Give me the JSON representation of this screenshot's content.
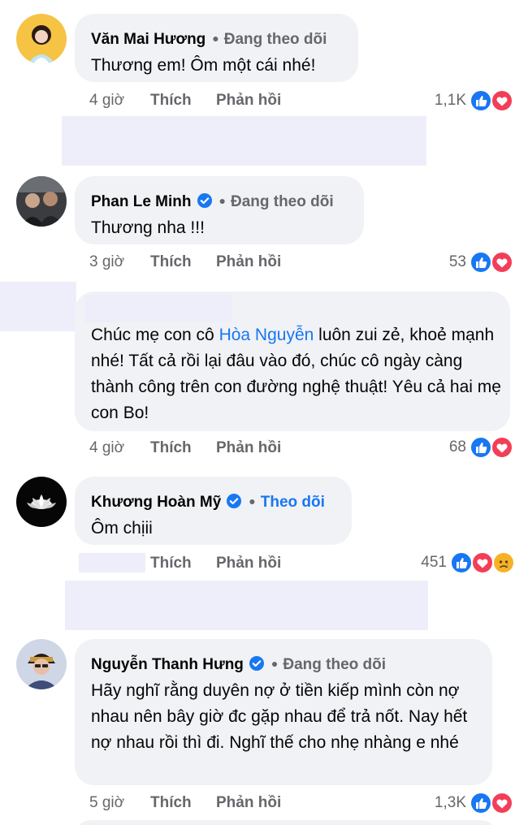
{
  "comments": [
    {
      "name": "Văn Mai Hương",
      "follow": "Đang theo dõi",
      "text": "Thương em! Ôm một cái nhé!",
      "time": "4 giờ",
      "like": "Thích",
      "reply": "Phản hồi",
      "reactions": "1,1K"
    },
    {
      "name": "Phan Le Minh",
      "follow": "Đang theo dõi",
      "text": "Thương nha !!!",
      "time": "3 giờ",
      "like": "Thích",
      "reply": "Phản hồi",
      "reactions": "53"
    },
    {
      "text_before": "Chúc mẹ con cô ",
      "mention": "Hòa Nguyễn",
      "text_after": " luôn zui zẻ, khoẻ mạnh nhé! Tất cả rồi lại đâu vào đó, chúc cô ngày càng thành công trên con đường nghệ thuật! Yêu cả hai mẹ con Bo!",
      "time": "4 giờ",
      "like": "Thích",
      "reply": "Phản hồi",
      "reactions": "68"
    },
    {
      "name": "Khương Hoàn Mỹ",
      "follow": "Theo dõi",
      "text": "Ôm chịii",
      "like": "Thích",
      "reply": "Phản hồi",
      "reactions": "451"
    },
    {
      "name": "Nguyễn Thanh Hưng",
      "follow": "Đang theo dõi",
      "text": "Hãy nghĩ rằng duyên nợ ở tiền kiếp mình còn nợ nhau nên bây giờ đc gặp nhau để trả nốt. Nay hết nợ nhau rồi thì đi. Nghĩ thế cho nhẹ nhàng e nhé",
      "time": "5 giờ",
      "like": "Thích",
      "reply": "Phản hồi",
      "reactions": "1,3K"
    }
  ],
  "colors": {
    "like_blue": "#1877f2",
    "love_red": "#f33e58",
    "sad_yellow": "#f7b125",
    "bubble_bg": "#f0f2f5",
    "secondary_text": "#65676b",
    "redaction": "#eeeefb"
  },
  "icons": {
    "verified": "verified-badge-icon",
    "like": "like-reaction-icon",
    "love": "love-reaction-icon",
    "sad": "sad-reaction-icon"
  }
}
